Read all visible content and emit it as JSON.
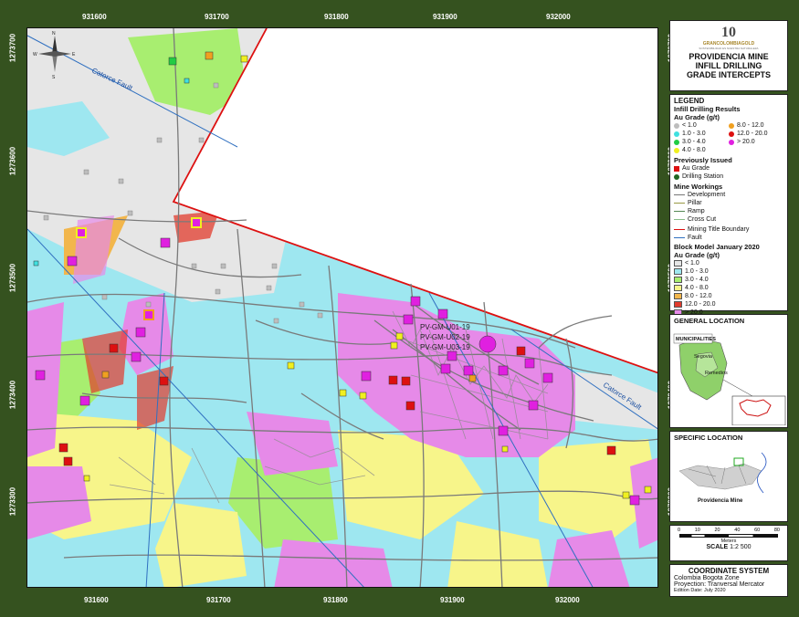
{
  "map": {
    "x_ticks": [
      "931600",
      "931700",
      "931800",
      "931900",
      "932000"
    ],
    "y_ticks": [
      "1273700",
      "1273600",
      "1273500",
      "1273400",
      "1273300"
    ],
    "fault_label": "Catorce Fault",
    "compass": {
      "n": "N",
      "s": "S",
      "e": "E",
      "w": "W"
    },
    "hole_labels": [
      "PV-GM-U01-19",
      "PV-GM-U02-19",
      "PV-GM-U03-19"
    ]
  },
  "logo": {
    "number": "10",
    "brand": "GRANCOLOMBIAGOLD",
    "tagline": "SOSTENIBILIDAD ES NUESTRA NATURALEZA"
  },
  "title": [
    "PROVIDENCIA MINE",
    "INFILL DRILLING",
    "GRADE INTERCEPTS"
  ],
  "legend": {
    "heading": "LEGEND",
    "infill_heading": "Infill Drilling Results",
    "au_grade": "Au Grade (g/t)",
    "grades": [
      {
        "label": "< 1.0",
        "color": "#bdbdbd"
      },
      {
        "label": "8.0 - 12.0",
        "color": "#f0a020"
      },
      {
        "label": "1.0 - 3.0",
        "color": "#40e0e0"
      },
      {
        "label": "12.0 - 20.0",
        "color": "#dd1010"
      },
      {
        "label": "3.0 - 4.0",
        "color": "#22cc44"
      },
      {
        "label": "> 20.0",
        "color": "#e020e0"
      },
      {
        "label": "4.0 - 8.0",
        "color": "#f0f020"
      }
    ],
    "prev_heading": "Previously Issued",
    "prev_items": [
      {
        "label": "Au Grade",
        "color": "#dd1010"
      },
      {
        "label": "Drilling Station",
        "color": "#226622"
      }
    ],
    "workings_heading": "Mine Workings",
    "workings": [
      {
        "label": "Development",
        "color": "#777777"
      },
      {
        "label": "Pillar",
        "color": "#999944"
      },
      {
        "label": "Ramp",
        "color": "#558855"
      },
      {
        "label": "Cross Cut",
        "color": "#88bb88"
      }
    ],
    "boundary_label": "Mining Title Boundary",
    "fault_item": "Fault",
    "block_heading": "Block Model January 2020",
    "block_grade": "Au Grade (g/t)",
    "block": [
      {
        "label": "< 1.0",
        "color": "#e6e6e6"
      },
      {
        "label": "1.0 - 3.0",
        "color": "#9ee7f0"
      },
      {
        "label": "3.0 - 4.0",
        "color": "#a8ee70"
      },
      {
        "label": "4.0 - 8.0",
        "color": "#f7f58a"
      },
      {
        "label": "8.0 - 12.0",
        "color": "#f2b64c"
      },
      {
        "label": "12.0 - 20.0",
        "color": "#e23b2c"
      },
      {
        "label": "> 20.0",
        "color": "#e68ae8"
      }
    ]
  },
  "general": {
    "title": "GENERAL LOCATION",
    "municipalities": "MUNICIPALITIES",
    "segovia": "Segovia",
    "remedios": "Remedios"
  },
  "specific": {
    "title": "SPECIFIC LOCATION",
    "label": "Providencia Mine"
  },
  "scale": {
    "ticks": [
      "0",
      "10",
      "20",
      "40",
      "60",
      "80"
    ],
    "unit": "Meters",
    "text": "SCALE",
    "ratio": "1:2 500"
  },
  "coords": {
    "title": "COORDINATE SYSTEM",
    "zone": "Colombia Bogota Zone",
    "projection": "Proyection: Tranversal Mercator",
    "edition": "Edition Date: July 2020"
  }
}
